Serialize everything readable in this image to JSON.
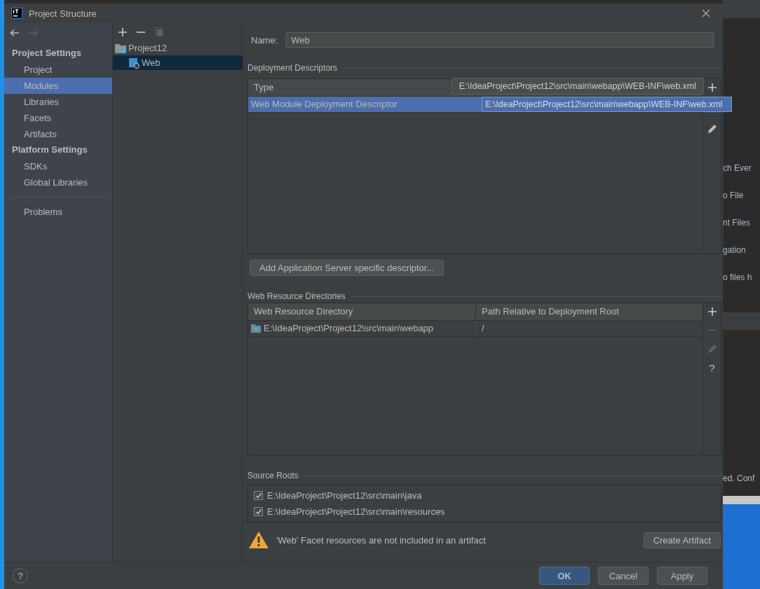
{
  "window": {
    "title": "Project Structure"
  },
  "sidebar": {
    "sections": [
      {
        "heading": "Project Settings",
        "items": [
          {
            "label": "Project",
            "selected": false
          },
          {
            "label": "Modules",
            "selected": true
          },
          {
            "label": "Libraries",
            "selected": false
          },
          {
            "label": "Facets",
            "selected": false
          },
          {
            "label": "Artifacts",
            "selected": false
          }
        ]
      },
      {
        "heading": "Platform Settings",
        "items": [
          {
            "label": "SDKs",
            "selected": false
          },
          {
            "label": "Global Libraries",
            "selected": false
          }
        ]
      }
    ],
    "footer_items": [
      {
        "label": "Problems",
        "selected": false
      }
    ]
  },
  "module_tree": {
    "items": [
      {
        "label": "Project12",
        "kind": "project",
        "selected": false,
        "children": [
          {
            "label": "Web",
            "kind": "web",
            "selected": true
          }
        ]
      }
    ]
  },
  "editor": {
    "name_label": "Name:",
    "name_value": "Web",
    "deployment_descriptors": {
      "title": "Deployment Descriptors",
      "columns": [
        "Type"
      ],
      "rows": [
        {
          "cells": [
            "Web Module Deployment Descriptor",
            "E:\\IdeaProject\\Project12\\src\\main\\webapp\\WEB-INF\\web.xml"
          ],
          "selected": true
        }
      ],
      "tooltip": "E:\\IdeaProject\\Project12\\src\\main\\webapp\\WEB-INF\\web.xml"
    },
    "add_descriptor_button": "Add Application Server specific descriptor...",
    "web_resource_directories": {
      "title": "Web Resource Directories",
      "columns": [
        "Web Resource Directory",
        "Path Relative to Deployment Root"
      ],
      "rows": [
        {
          "cells": [
            "E:\\IdeaProject\\Project12\\src\\main\\webapp",
            "/"
          ],
          "selected": false
        }
      ],
      "help": "?"
    },
    "source_roots": {
      "title": "Source Roots",
      "items": [
        {
          "path": "E:\\IdeaProject\\Project12\\src\\main\\java",
          "checked": true
        },
        {
          "path": "E:\\IdeaProject\\Project12\\src\\main\\resources",
          "checked": true
        }
      ]
    },
    "warning": {
      "text": "'Web' Facet resources are not included in an artifact",
      "button": "Create Artifact"
    }
  },
  "footer": {
    "help": "?",
    "buttons": [
      {
        "label": "OK",
        "kind": "primary"
      },
      {
        "label": "Cancel",
        "kind": "normal"
      },
      {
        "label": "Apply",
        "kind": "normal"
      }
    ]
  },
  "background_editor": {
    "lines": [
      "ch Ever",
      "o File",
      "nt Files",
      "gation",
      "o files h"
    ],
    "status_text": "ed.  Conf"
  }
}
